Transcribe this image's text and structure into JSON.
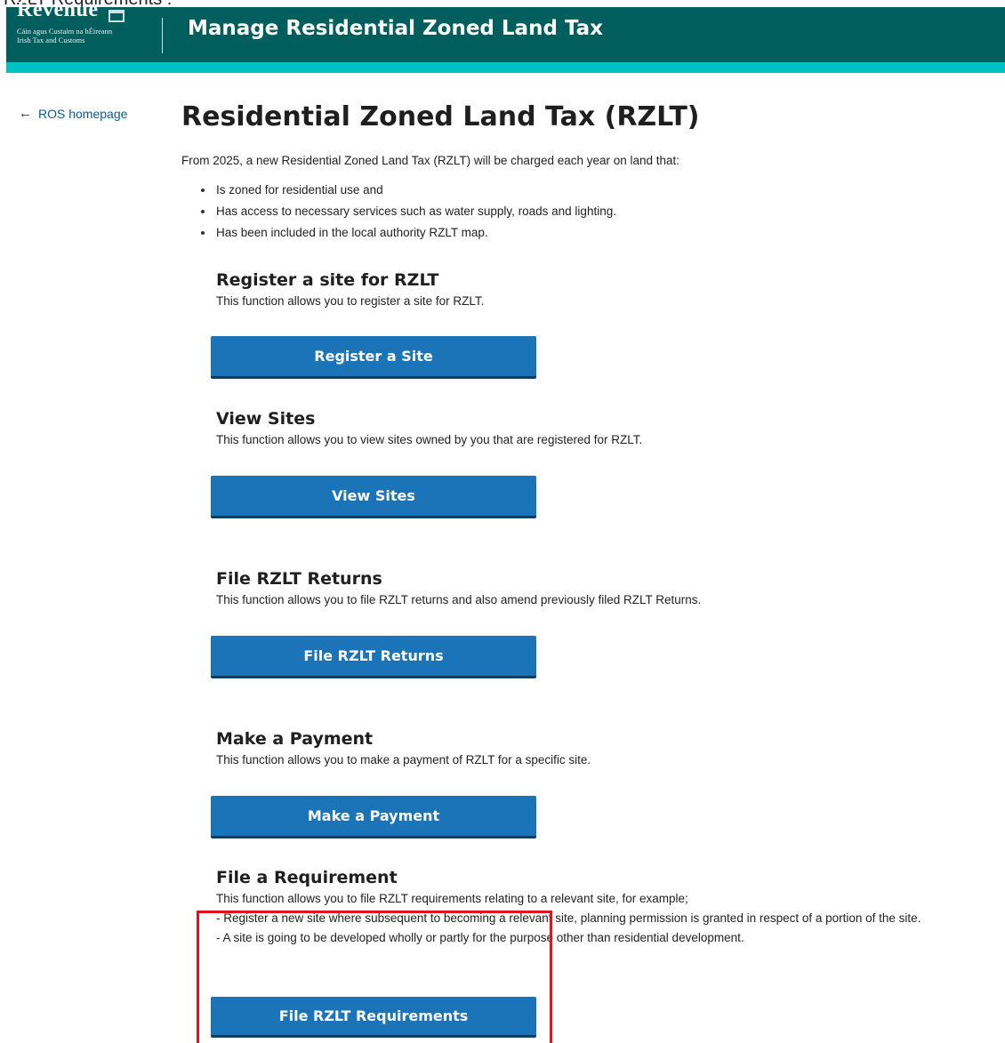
{
  "caption": "RZLT Requirements :",
  "header": {
    "logo_word": "Revenue",
    "logo_line1": "Cáin agus Custaim na hÉireann",
    "logo_line2": "Irish Tax and Customs",
    "title": "Manage Residential Zoned Land Tax"
  },
  "nav": {
    "back_label": "ROS homepage"
  },
  "page": {
    "title": "Residential Zoned Land Tax (RZLT)",
    "intro": "From 2025, a new Residential Zoned Land Tax (RZLT) will be charged each year on land that:",
    "bullets": [
      "Is zoned for residential use and",
      "Has access to necessary services such as water supply, roads and lighting.",
      "Has been included in the local authority RZLT map."
    ]
  },
  "sections": [
    {
      "heading": "Register a site for RZLT",
      "description": "This function allows you to register a site for RZLT.",
      "button": "Register a Site"
    },
    {
      "heading": "View Sites",
      "description": "This function allows you to view sites owned by you that are registered for RZLT.",
      "button": "View Sites"
    },
    {
      "heading": "File RZLT Returns",
      "description": "This function allows you to file RZLT returns and also amend previously filed RZLT Returns.",
      "button": "File RZLT Returns"
    },
    {
      "heading": "Make a Payment",
      "description": "This function allows you to make a payment of RZLT for a specific site.",
      "button": "Make a Payment"
    },
    {
      "heading": "File a Requirement",
      "description": "This function allows you to file RZLT requirements relating to a relevant site, for example;",
      "detail_1": "- Register a new site where subsequent to becoming a relevant site, planning permission is granted in respect of a portion of the site.",
      "detail_2": "- A site is going to be developed wholly or partly for the purpose other than residential development.",
      "button": "File RZLT Requirements"
    }
  ],
  "colors": {
    "header_bg": "#005e5d",
    "header_accent": "#00c2c4",
    "button_bg": "#1b74b8",
    "highlight": "#e0141e"
  }
}
